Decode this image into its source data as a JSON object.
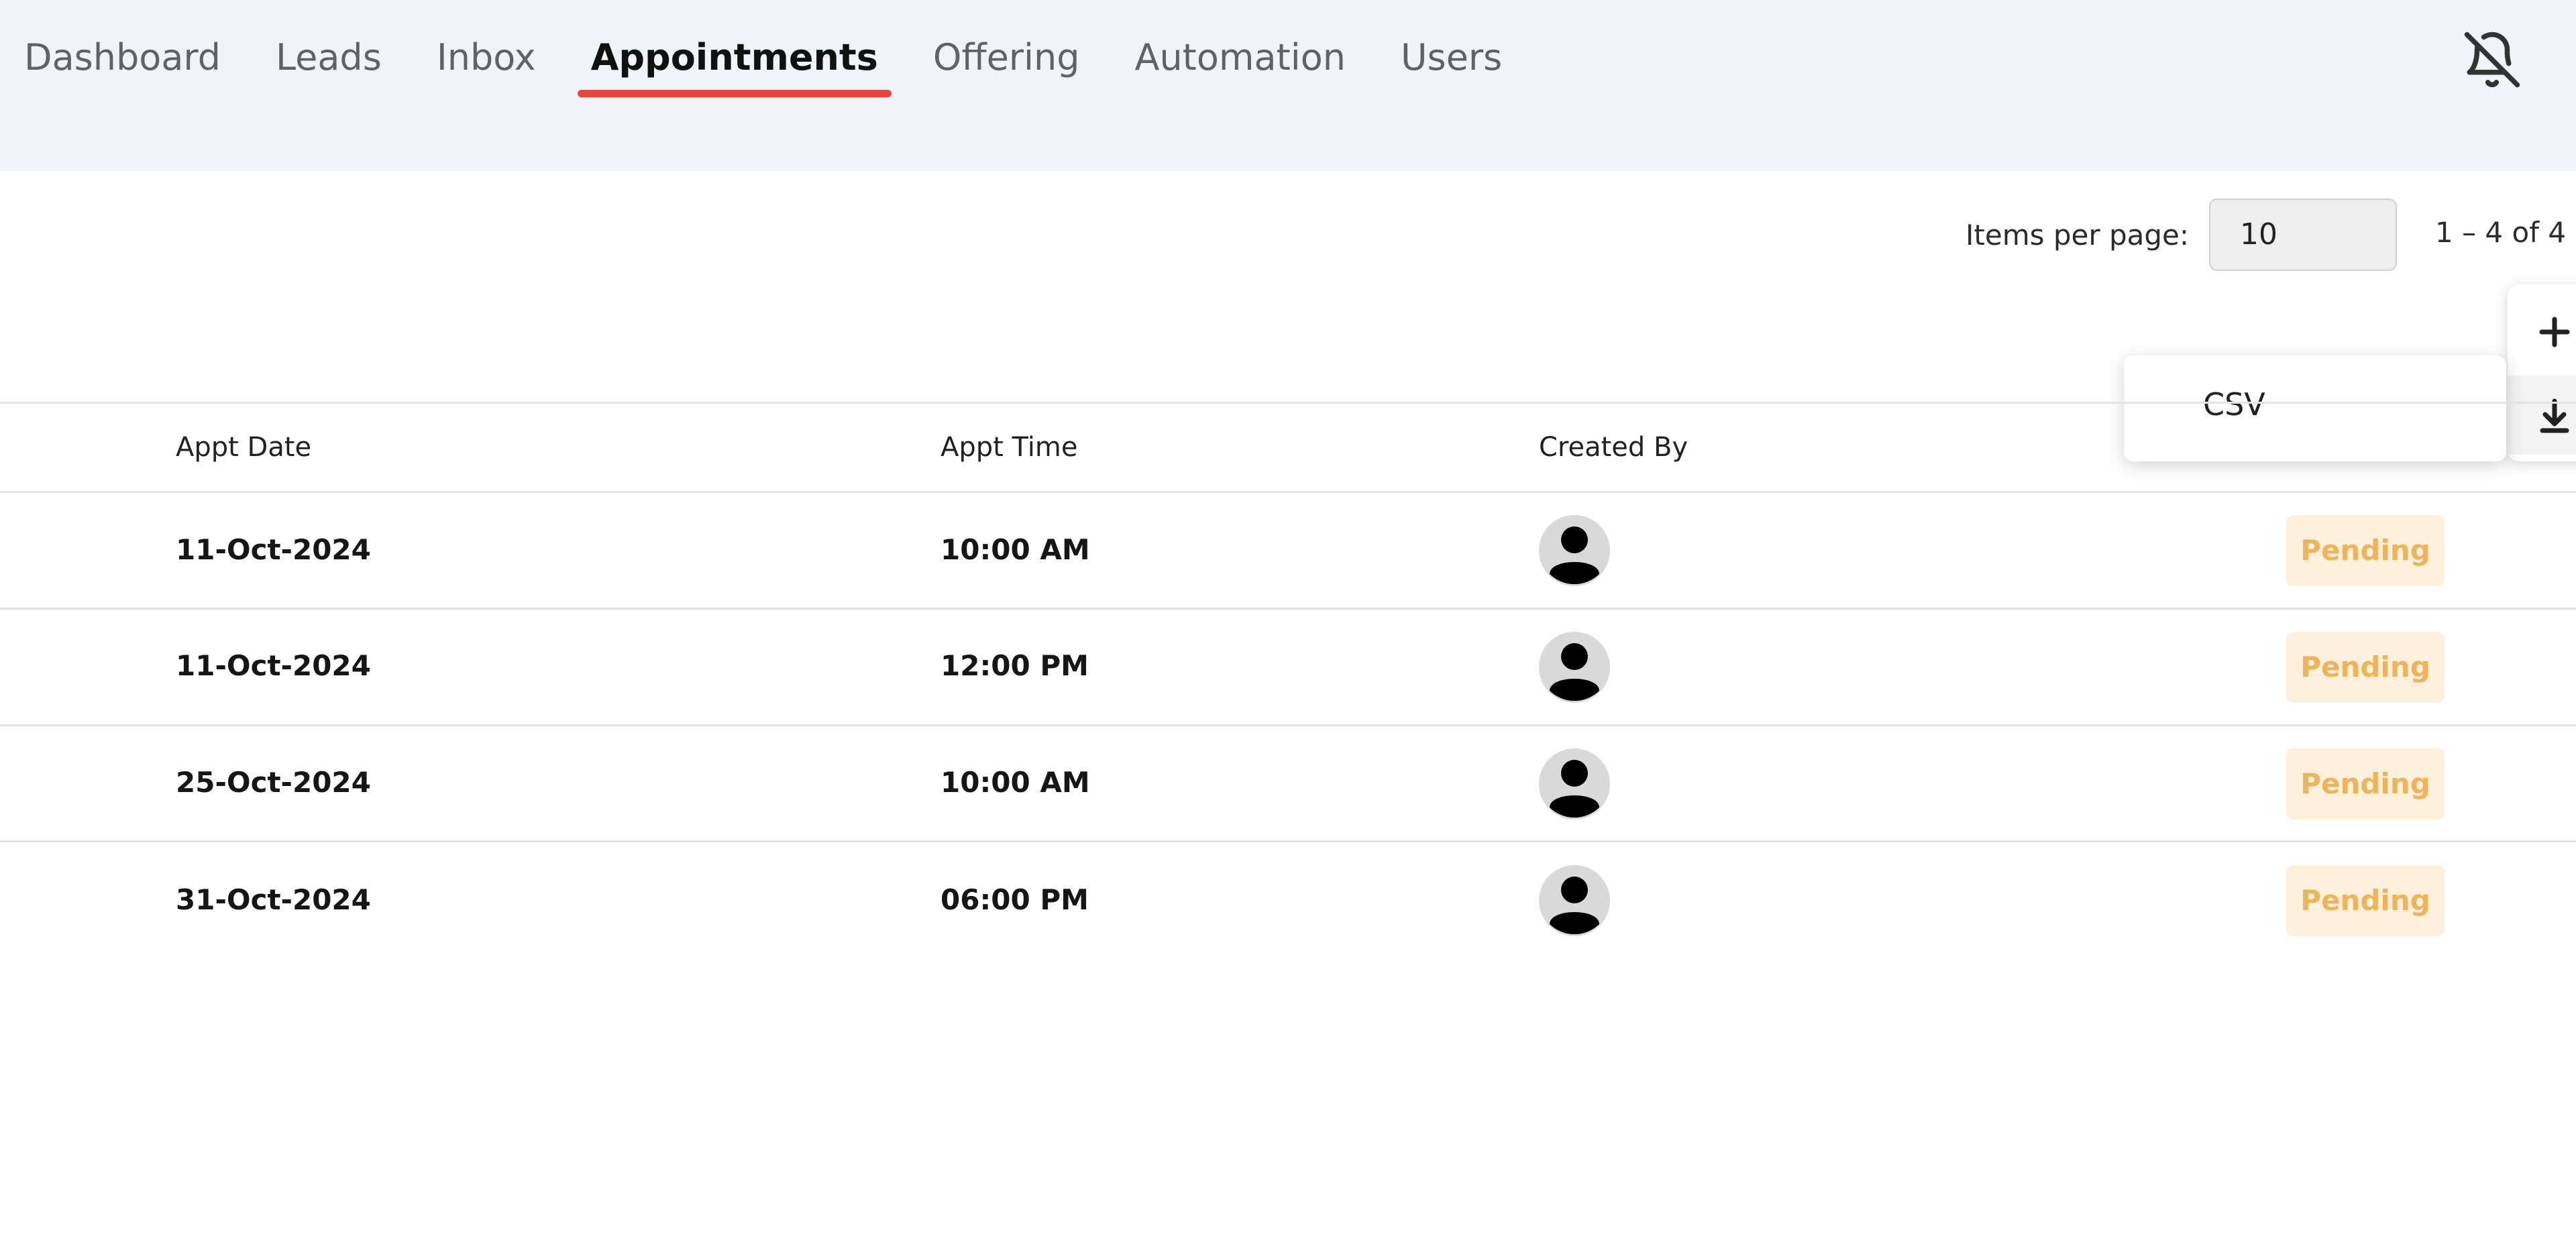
{
  "nav": {
    "items": [
      {
        "label": "Dashboard"
      },
      {
        "label": "Leads"
      },
      {
        "label": "Inbox"
      },
      {
        "label": "Appointments"
      },
      {
        "label": "Offering"
      },
      {
        "label": "Automation"
      },
      {
        "label": "Users"
      }
    ],
    "active_index": 3,
    "notification_icon": "bell-off-icon"
  },
  "pagination": {
    "items_per_page_label": "Items per page:",
    "items_per_page_value": "10",
    "range_text": "1 – 4 of 4"
  },
  "actions": {
    "add_icon": "plus-icon",
    "download_icon": "download-icon"
  },
  "export_menu": {
    "items": [
      {
        "label": "CSV"
      }
    ]
  },
  "table": {
    "columns": [
      "Appt Date",
      "Appt Time",
      "Created By"
    ],
    "rows": [
      {
        "date": "11-Oct-2024",
        "time": "10:00 AM",
        "created_by_icon": "user-avatar-icon",
        "status": "Pending"
      },
      {
        "date": "11-Oct-2024",
        "time": "12:00 PM",
        "created_by_icon": "user-avatar-icon",
        "status": "Pending"
      },
      {
        "date": "25-Oct-2024",
        "time": "10:00 AM",
        "created_by_icon": "user-avatar-icon",
        "status": "Pending"
      },
      {
        "date": "31-Oct-2024",
        "time": "06:00 PM",
        "created_by_icon": "user-avatar-icon",
        "status": "Pending"
      }
    ]
  },
  "colors": {
    "topbar_bg": "#f0f4f8",
    "active_tab_underline": "#e8453c",
    "pending_bg": "#fdf0dc",
    "pending_text": "#efb45a"
  }
}
